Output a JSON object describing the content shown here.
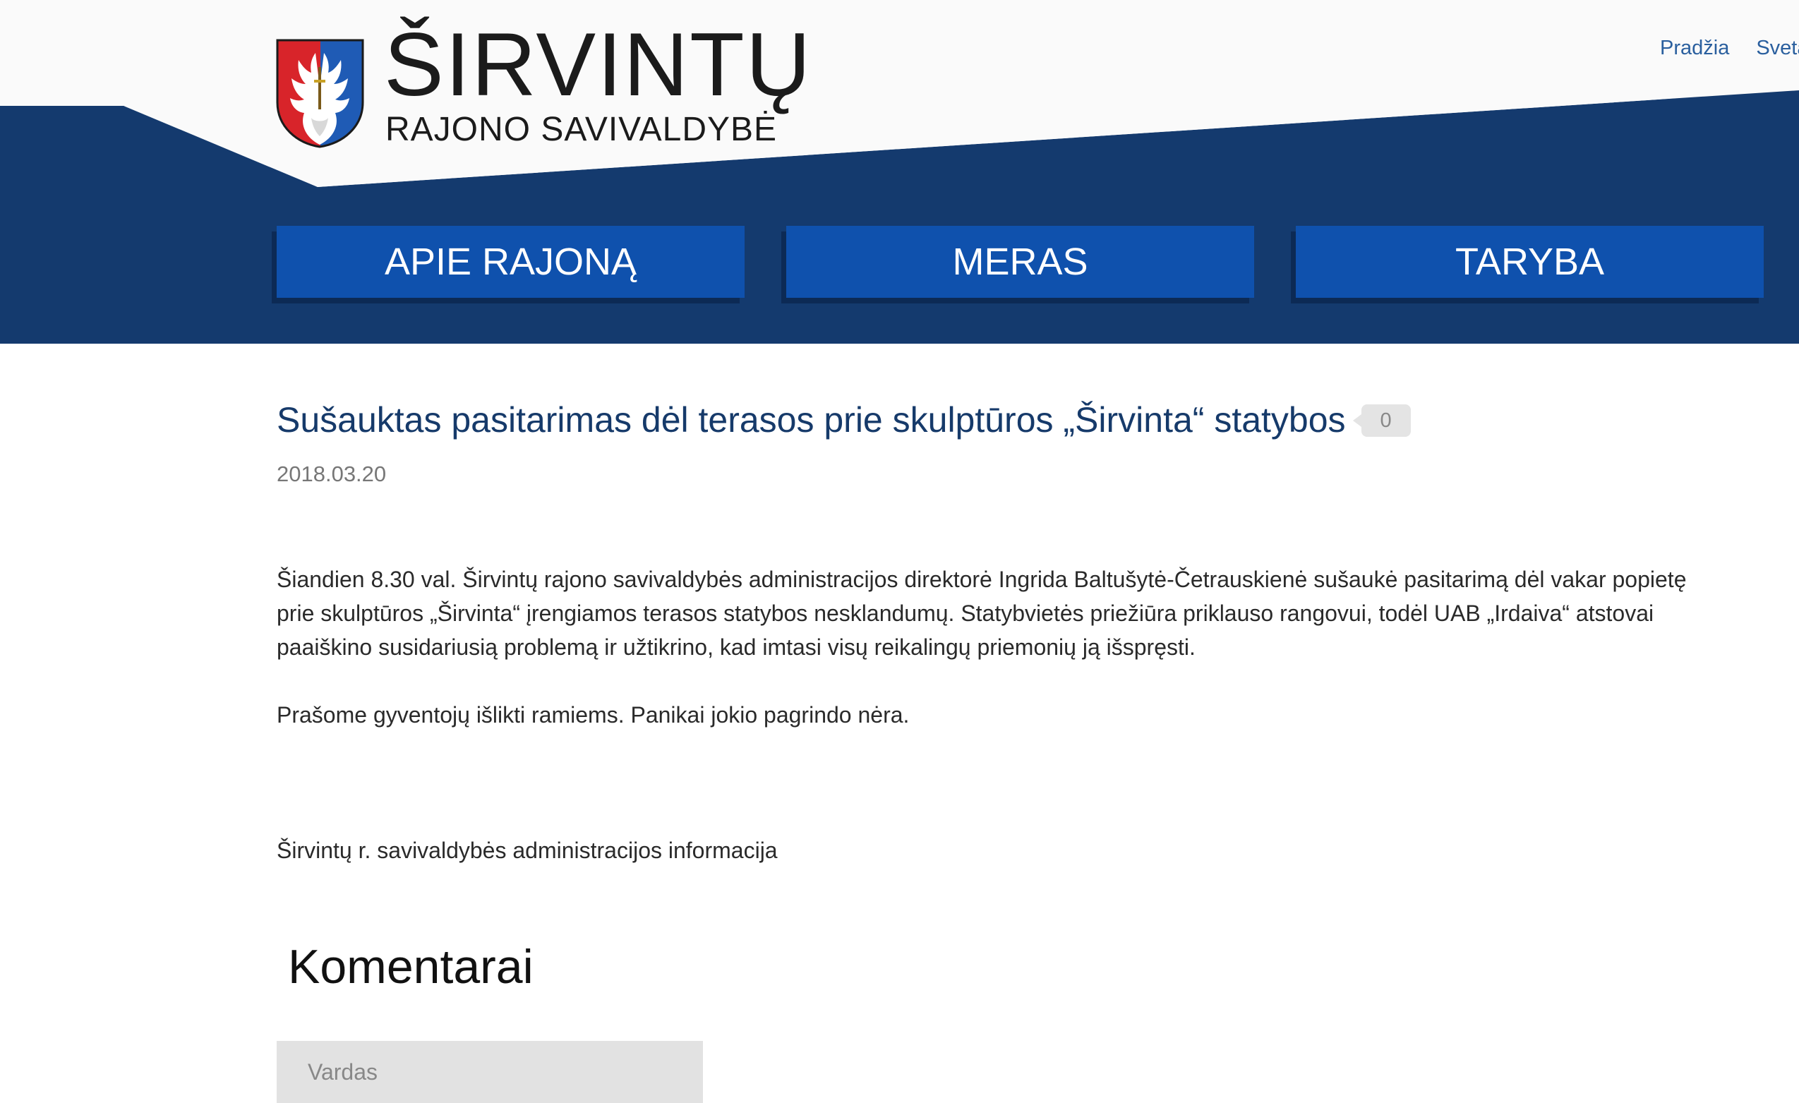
{
  "header": {
    "brand_title": "ŠIRVINTŲ",
    "brand_subtitle": "RAJONO SAVIVALDYBĖ",
    "top_links": [
      {
        "label": "Pradžia"
      },
      {
        "label": "Sveta"
      }
    ],
    "nav": [
      {
        "label": "APIE RAJONĄ"
      },
      {
        "label": "MERAS"
      },
      {
        "label": "TARYBA"
      }
    ],
    "colors": {
      "header_band": "#143a6e",
      "nav_button": "#0f51ad",
      "link": "#2a5f9e"
    }
  },
  "article": {
    "title": "Sušauktas pasitarimas dėl terasos prie skulptūros „Širvinta“ statybos",
    "comment_count": "0",
    "date": "2018.03.20",
    "paragraphs": [
      "Šiandien 8.30 val. Širvintų rajono savivaldybės administracijos direktorė Ingrida Baltušytė-Četrauskienė sušaukė pasitarimą dėl vakar popietę prie skulptūros „Širvinta“ įrengiamos terasos statybos nesklandumų. Statybvietės priežiūra priklauso rangovui, todėl UAB „Irdaiva“ atstovai paaiškino susidariusią problemą ir užtikrino, kad imtasi visų reikalingų priemonių ją išspręsti.",
      "Prašome gyventojų išlikti ramiems. Panikai jokio pagrindo nėra."
    ],
    "source": "Širvintų r. savivaldybės administracijos informacija"
  },
  "comments": {
    "title": "Komentarai",
    "name_placeholder": "Vardas",
    "name_value": ""
  },
  "icons": {
    "crest": "municipal-coat-of-arms-icon"
  }
}
